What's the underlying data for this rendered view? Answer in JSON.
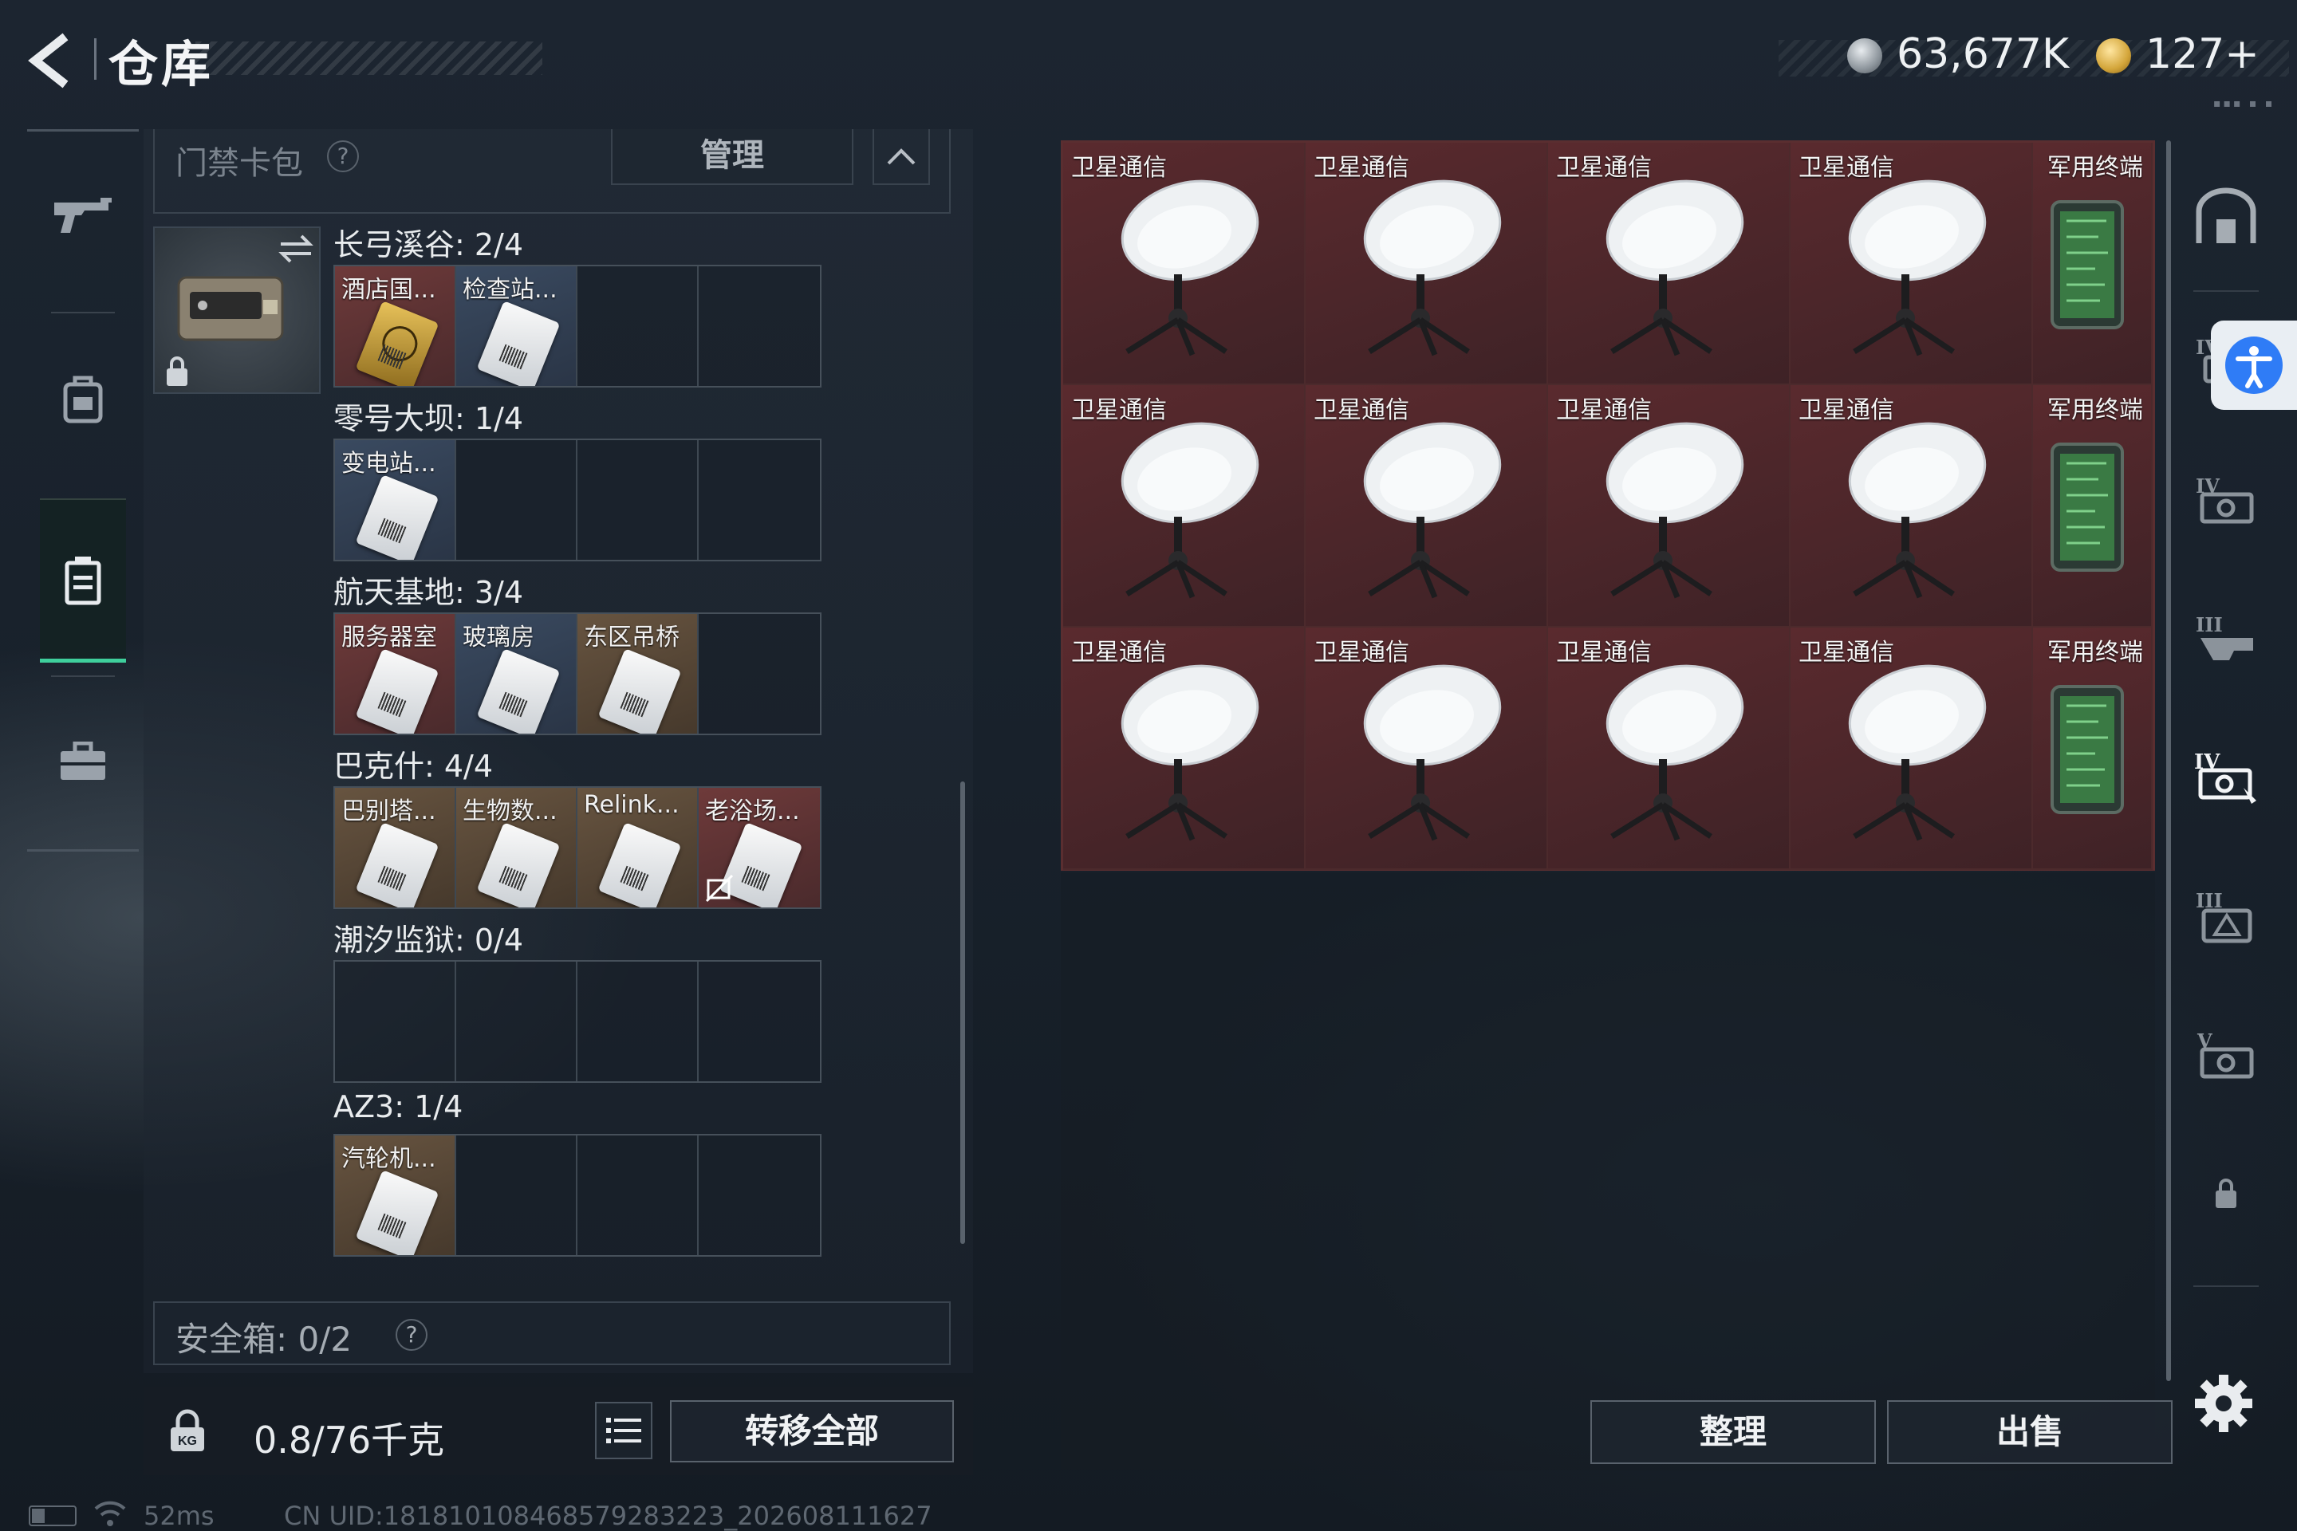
{
  "header": {
    "title": "仓库",
    "currency_1": "63,677K",
    "currency_2": "127+",
    "mini_dots": "▪▪▪ ▪ ▪"
  },
  "keycard_panel": {
    "title": "门禁卡包",
    "help": "?",
    "manage_label": "管理",
    "groups": [
      {
        "label": "长弓溪谷: 2/4",
        "slots": [
          {
            "name": "酒店国...",
            "style": "red"
          },
          {
            "name": "检查站...",
            "style": "blue"
          },
          {
            "name": "",
            "style": "empty"
          },
          {
            "name": "",
            "style": "empty"
          }
        ]
      },
      {
        "label": "零号大坝: 1/4",
        "slots": [
          {
            "name": "变电站...",
            "style": "blue"
          },
          {
            "name": "",
            "style": "empty"
          },
          {
            "name": "",
            "style": "empty"
          },
          {
            "name": "",
            "style": "empty"
          }
        ]
      },
      {
        "label": "航天基地: 3/4",
        "slots": [
          {
            "name": "服务器室",
            "style": "red"
          },
          {
            "name": "玻璃房",
            "style": "blue"
          },
          {
            "name": "东区吊桥",
            "style": "gold"
          },
          {
            "name": "",
            "style": "empty"
          }
        ]
      },
      {
        "label": "巴克什: 4/4",
        "slots": [
          {
            "name": "巴别塔...",
            "style": "gold"
          },
          {
            "name": "生物数...",
            "style": "gold"
          },
          {
            "name": "Relink...",
            "style": "gold"
          },
          {
            "name": "老浴场...",
            "style": "red"
          }
        ]
      },
      {
        "label": "潮汐监狱: 0/4",
        "slots": [
          {
            "name": "",
            "style": "empty"
          },
          {
            "name": "",
            "style": "empty"
          },
          {
            "name": "",
            "style": "empty"
          },
          {
            "name": "",
            "style": "empty"
          }
        ]
      },
      {
        "label": "AZ3: 1/4",
        "slots": [
          {
            "name": "汽轮机...",
            "style": "gold"
          },
          {
            "name": "",
            "style": "empty"
          },
          {
            "name": "",
            "style": "empty"
          },
          {
            "name": "",
            "style": "empty"
          }
        ]
      }
    ],
    "safebox_label": "安全箱: 0/2",
    "safebox_help": "?"
  },
  "bottom_left": {
    "weight": "0.8/76千克",
    "transfer_label": "转移全部"
  },
  "storage": {
    "rows": [
      [
        "卫星通信",
        "卫星通信",
        "卫星通信",
        "卫星通信",
        "军用终端"
      ],
      [
        "卫星通信",
        "卫星通信",
        "卫星通信",
        "卫星通信",
        "军用终端"
      ],
      [
        "卫星通信",
        "卫星通信",
        "卫星通信",
        "卫星通信",
        "军用终端"
      ]
    ],
    "sort_label": "整理",
    "sell_label": "出售"
  },
  "status_bar": {
    "ping": "52ms",
    "uid": "CN UID:181810108468579283223_202608111627"
  },
  "colors": {
    "accent_green": "#3fcf9c",
    "item_red": "#5a2a2e",
    "a11y_blue": "#2f7cf6"
  },
  "icons": {
    "left_rail": [
      "gun-icon",
      "backpack-icon",
      "keycard-case-icon",
      "briefcase-icon"
    ],
    "right_rail": [
      "warehouse-icon",
      "tier-iv-category-icon",
      "tier-iv-gear-icon",
      "tier-iii-category-icon",
      "tier-iv-selected-icon",
      "tier-iii-armor-icon",
      "tier-v-category-icon",
      "lock-icon"
    ]
  }
}
